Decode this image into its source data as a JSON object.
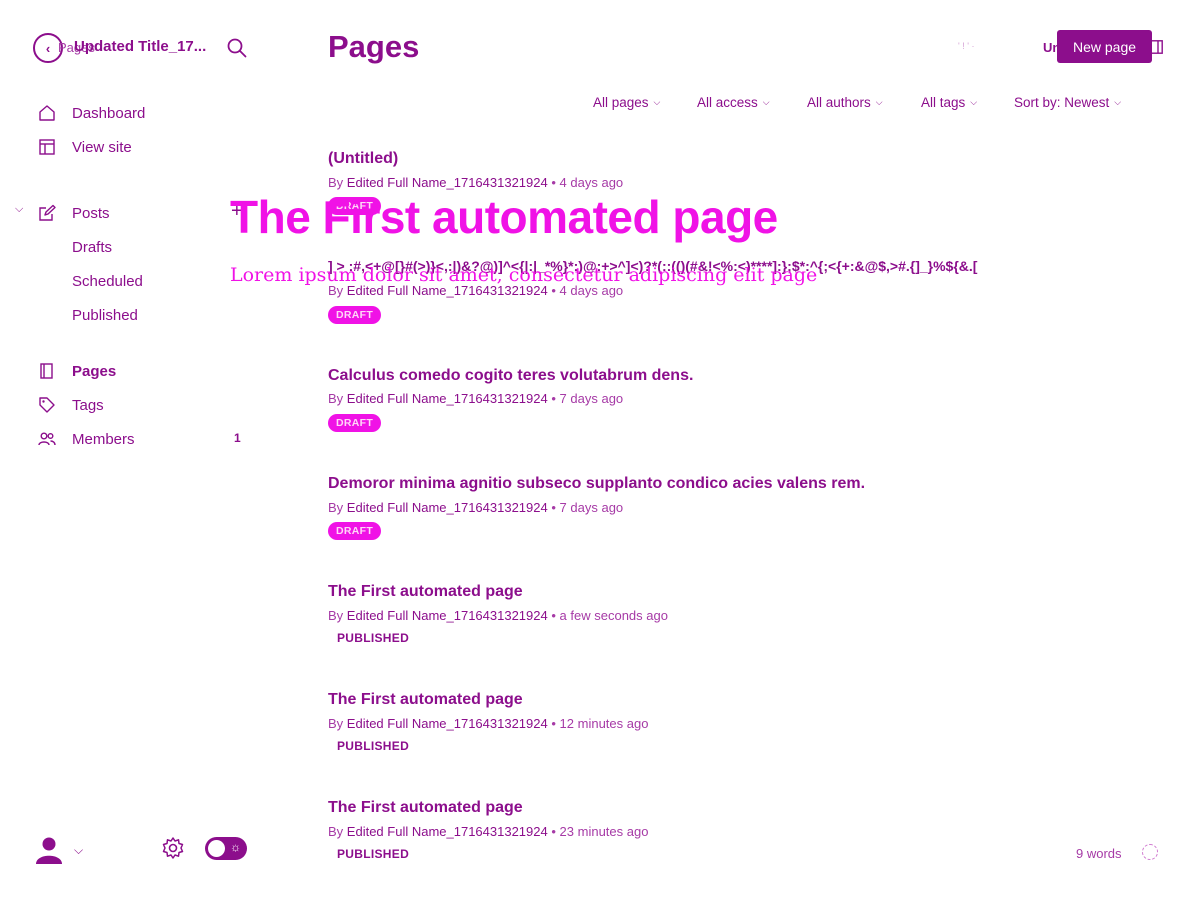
{
  "editor": {
    "back_label": "Pages",
    "post_title": "Updated Title_17...",
    "status_right": "Un",
    "word_count": "9 words",
    "overlay_title": "The First automated page",
    "overlay_subtitle": "Lorem ipsum dolor sit amet, consectetur adipiscing elit page"
  },
  "sidebar": {
    "nav": [
      {
        "label": "Dashboard",
        "icon": "home-icon"
      },
      {
        "label": "View site",
        "icon": "layout-icon"
      }
    ],
    "posts": {
      "label": "Posts",
      "icon": "edit-icon"
    },
    "post_sub": [
      {
        "label": "Drafts"
      },
      {
        "label": "Scheduled"
      },
      {
        "label": "Published"
      }
    ],
    "pages": {
      "label": "Pages",
      "icon": "page-icon"
    },
    "tags": {
      "label": "Tags",
      "icon": "tag-icon"
    },
    "members": {
      "label": "Members",
      "icon": "members-icon",
      "count": "1"
    }
  },
  "header": {
    "title": "Pages",
    "new_button": "New page"
  },
  "filters": [
    {
      "label": "All pages"
    },
    {
      "label": "All access"
    },
    {
      "label": "All authors"
    },
    {
      "label": "All tags"
    },
    {
      "label": "Sort by: Newest"
    }
  ],
  "rows": [
    {
      "title": "(Untitled)",
      "by": "By",
      "author": "Edited Full Name_1716431321924",
      "time": "4 days ago",
      "status": "DRAFT"
    },
    {
      "title": "] > :#,<+@[}#(>)}<,:|)&?@)]^<{|:|_*%}*:)@:+>^]<)?*(::(()(#&!<%:<)****]:};$*:^{;<{+:&@$,>#.{]_}%${&.[",
      "by": "By",
      "author": "Edited Full Name_1716431321924",
      "time": "4 days ago",
      "status": "DRAFT"
    },
    {
      "title": "Calculus comedo cogito teres volutabrum dens.",
      "by": "By",
      "author": "Edited Full Name_1716431321924",
      "time": "7 days ago",
      "status": "DRAFT"
    },
    {
      "title": "Demoror minima agnitio subseco supplanto condico acies valens rem.",
      "by": "By",
      "author": "Edited Full Name_1716431321924",
      "time": "7 days ago",
      "status": "DRAFT"
    },
    {
      "title": "The First automated page",
      "by": "By",
      "author": "Edited Full Name_1716431321924",
      "time": "a few seconds ago",
      "status": "PUBLISHED"
    },
    {
      "title": "The First automated page",
      "by": "By",
      "author": "Edited Full Name_1716431321924",
      "time": "12 minutes ago",
      "status": "PUBLISHED"
    },
    {
      "title": "The First automated page",
      "by": "By",
      "author": "Edited Full Name_1716431321924",
      "time": "23 minutes ago",
      "status": "PUBLISHED"
    }
  ],
  "colors": {
    "primary": "#8c0e8c",
    "accent": "#f012e6"
  },
  "icons": {
    "back": "chevron-left-icon",
    "search": "search-icon",
    "settings": "gear-icon",
    "theme": "theme-toggle-icon",
    "avatar": "avatar-icon",
    "sidebar_toggle": "sidebar-toggle-icon"
  }
}
